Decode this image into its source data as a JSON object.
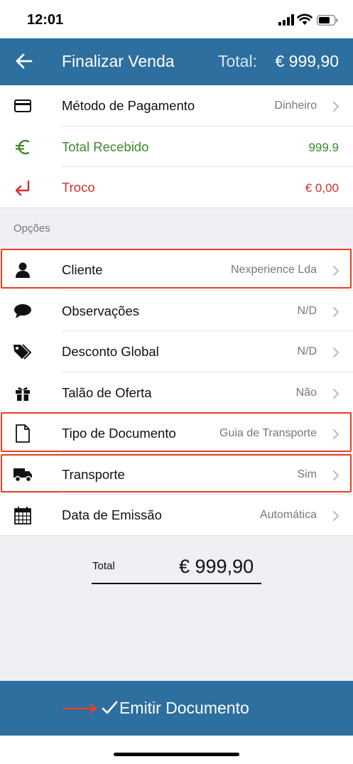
{
  "status_bar": {
    "time": "12:01"
  },
  "header": {
    "title": "Finalizar Venda",
    "total_label": "Total:",
    "total_value": "€ 999,90"
  },
  "payment": [
    {
      "icon": "credit-card-icon",
      "label": "Método de Pagamento",
      "value": "Dinheiro"
    },
    {
      "icon": "euro-icon",
      "label": "Total Recebido",
      "value": "999.9",
      "color": "#3a8a2a"
    },
    {
      "icon": "return-arrow-icon",
      "label": "Troco",
      "value": "€ 0,00",
      "color": "#d1302b"
    }
  ],
  "options": {
    "section_title": "Opções",
    "items": [
      {
        "icon": "user-icon",
        "label": "Cliente",
        "value": "Nexperience Lda",
        "highlighted": true
      },
      {
        "icon": "speech-bubble-icon",
        "label": "Observações",
        "value": "N/D"
      },
      {
        "icon": "tags-icon",
        "label": "Desconto Global",
        "value": "N/D"
      },
      {
        "icon": "gift-icon",
        "label": "Talão de Oferta",
        "value": "Não"
      },
      {
        "icon": "document-icon",
        "label": "Tipo de Documento",
        "value": "Guia de Transporte",
        "highlighted": true
      },
      {
        "icon": "truck-icon",
        "label": "Transporte",
        "value": "Sim",
        "highlighted": true
      },
      {
        "icon": "calendar-icon",
        "label": "Data de Emissão",
        "value": "Automática"
      }
    ]
  },
  "summary": {
    "label": "Total",
    "value": "€ 999,90"
  },
  "emit_button": {
    "label": "Emitir Documento"
  },
  "colors": {
    "header": "#2d6f9f",
    "highlight": "#e53f26",
    "green": "#3a8a2a",
    "red": "#d1302b"
  }
}
